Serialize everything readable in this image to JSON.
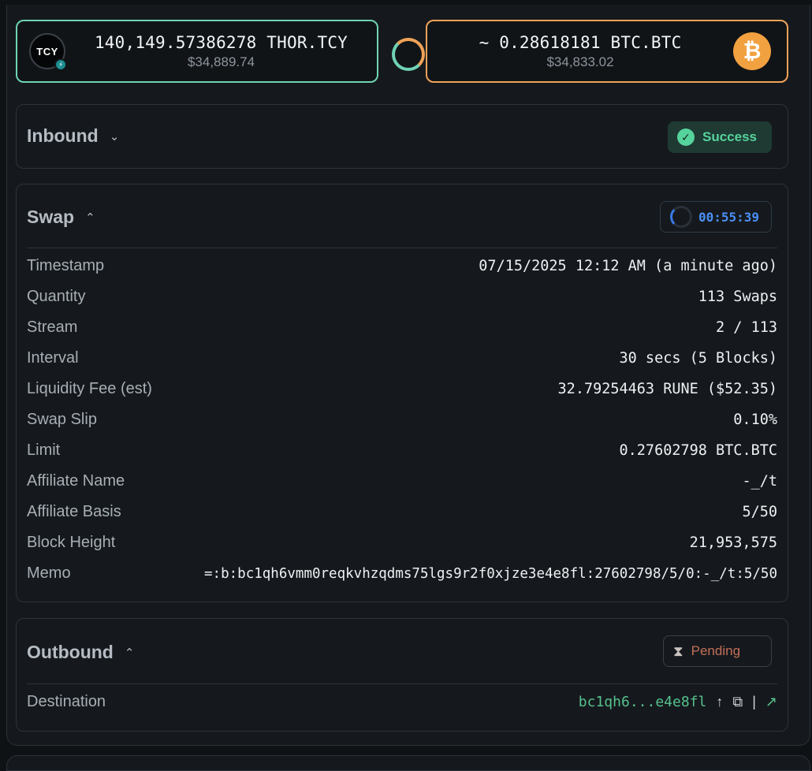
{
  "swap": {
    "from": {
      "amount": "140,149.57386278 THOR.TCY",
      "usd": "$34,889.74",
      "logo_text": "TCY",
      "badge_icon": "thorchain-icon"
    },
    "to": {
      "amount": "~ 0.28618181 BTC.BTC",
      "usd": "$34,833.02",
      "logo_glyph": "₿"
    },
    "colors": {
      "from_accent": "#6fd3b3",
      "to_accent": "#f0a358"
    }
  },
  "inbound": {
    "title": "Inbound",
    "chevron": "⌄",
    "status": "Success",
    "status_color": "#56d39c",
    "check": "✓"
  },
  "swap_section": {
    "title": "Swap",
    "chevron": "⌃",
    "timer": "00:55:39",
    "rows": [
      {
        "label": "Timestamp",
        "value": "07/15/2025 12:12 AM (a minute ago)"
      },
      {
        "label": "Quantity",
        "value": "113 Swaps"
      },
      {
        "label": "Stream",
        "value": "2 / 113"
      },
      {
        "label": "Interval",
        "value": "30 secs (5 Blocks)"
      },
      {
        "label": "Liquidity Fee (est)",
        "value": "32.79254463 RUNE ($52.35)"
      },
      {
        "label": "Swap Slip",
        "value": "0.10%"
      },
      {
        "label": "Limit",
        "value": "0.27602798 BTC.BTC"
      },
      {
        "label": "Affiliate Name",
        "value": "-_/t"
      },
      {
        "label": "Affiliate Basis",
        "value": "5/50"
      },
      {
        "label": "Block Height",
        "value": "21,953,575"
      },
      {
        "label": "Memo",
        "value": "=:b:bc1qh6vmm0reqkvhzqdms75lgs9r2f0xjze3e4e8fl:27602798/5/0:-_/t:5/50"
      }
    ]
  },
  "outbound": {
    "title": "Outbound",
    "chevron": "⌃",
    "status": "Pending",
    "status_color": "#c46f58",
    "destination_label": "Destination",
    "destination_value": "bc1qh6...e4e8fl",
    "arrow": "↑",
    "separator": "|",
    "copy_glyph": "⧉",
    "external_glyph": "↗"
  }
}
